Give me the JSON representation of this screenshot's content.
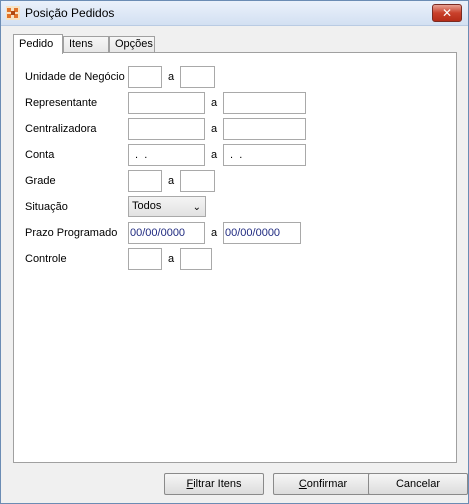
{
  "window": {
    "title": "Posição Pedidos",
    "close_glyph": "✕"
  },
  "tabs": [
    {
      "label": "Pedido",
      "active": true
    },
    {
      "label": "Itens",
      "active": false
    },
    {
      "label": "Opções",
      "active": false
    }
  ],
  "form": {
    "range_separator": "a",
    "unidade_negocio": {
      "label": "Unidade de Negócio",
      "from": "",
      "to": ""
    },
    "representante": {
      "label": "Representante",
      "from": "",
      "to": ""
    },
    "centralizadora": {
      "label": "Centralizadora",
      "from": "",
      "to": ""
    },
    "conta": {
      "label": "Conta",
      "from": " .  .",
      "to": " .  ."
    },
    "grade": {
      "label": "Grade",
      "from": "",
      "to": ""
    },
    "situacao": {
      "label": "Situação",
      "value": "Todos"
    },
    "prazo_programado": {
      "label": "Prazo Programado",
      "from": "00/00/0000",
      "to": "00/00/0000"
    },
    "controle": {
      "label": "Controle",
      "from": "",
      "to": ""
    }
  },
  "buttons": {
    "filtrar_itens": {
      "accel": "F",
      "rest": "iltrar Itens"
    },
    "confirmar": {
      "accel": "C",
      "rest": "onfirmar"
    },
    "cancelar": {
      "accel": "",
      "rest": "Cancelar"
    }
  },
  "colors": {
    "close_red": "#c9402b",
    "date_text": "#1f2a80",
    "titlebar": "#d3e0f2"
  },
  "icons": {
    "app": "app-icon",
    "close": "close-icon",
    "dropdown": "chevron-down-icon"
  }
}
